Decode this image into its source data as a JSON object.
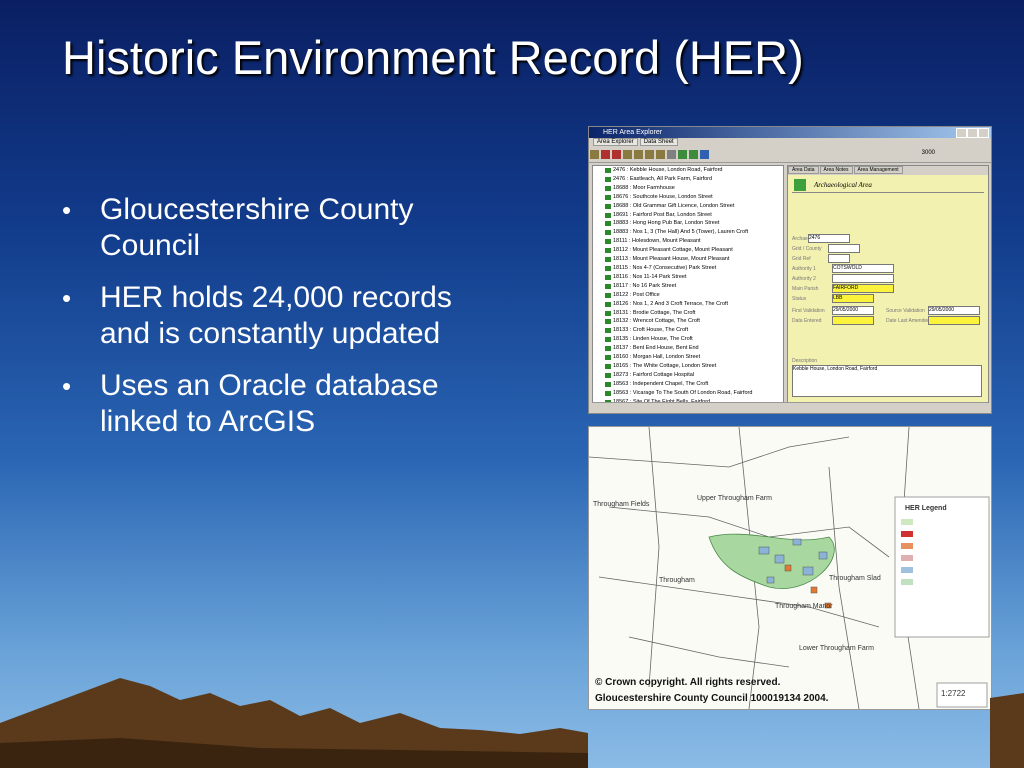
{
  "slide": {
    "title": "Historic Environment Record (HER)",
    "bullets": [
      "Gloucestershire County Council",
      "HER holds 24,000 records and is constantly updated",
      "Uses an Oracle database linked to ArcGIS"
    ],
    "bullet_glyph": "•",
    "colors": {
      "title": "#ffffff",
      "bg_top": "#0a1f63",
      "bg_bottom": "#8bbbe6",
      "mountains": "#5a3a1a"
    }
  },
  "her_window": {
    "title": "HER Area Explorer",
    "tabs": [
      "Area Explorer",
      "Data Sheet"
    ],
    "record_count": "3000",
    "tree_items": [
      "2476 : Kebble House, London Road, Fairford",
      "2476 : Eastleach, All Park Farm, Fairford",
      "18688 : Moor Farmhouse",
      "18676 : Southcote House, London Street",
      "18688 : Old Grammar Gift Licence, London Street",
      "18691 : Fairford Post Bar, London Street",
      "18883 : Hong Hong Pub Bar, London Street",
      "18883 : Nos 1, 3 (The Hall) And 5 (Tower), Lauren Croft",
      "18111 : Holesdown, Mount Pleasant",
      "18112 : Mount Pleasant Cottage, Mount Pleasant",
      "18113 : Mount Pleasant House, Mount Pleasant",
      "18115 : Nos 4-7 (Consecutive) Park Street",
      "18116 : Nos 11-14 Park Street",
      "18117 : No 16 Park Street",
      "18122 : Post Office",
      "18126 : Nos 1, 2 And 3 Croft Terrace, The Croft",
      "18131 : Brodie Cottage, The Croft",
      "18132 : Wrencot Cottage, The Croft",
      "18133 : Croft House, The Croft",
      "18135 : Linden House, The Croft",
      "18137 : Bent End House, Bent End",
      "18160 : Morgan Hall, London Street",
      "18165 : The White Cottage, London Street",
      "18273 : Fairford Cottage Hospital",
      "18563 : Independent Chapel, The Croft",
      "18563 : Vicarage To The South Of London Road, Fairford",
      "18567 : Site Of The Eight Bells, Fairford"
    ],
    "panel_tabs": [
      "Area Data",
      "Area Notes",
      "Area Management"
    ],
    "panel_header": "Archaeological Area",
    "fields": [
      {
        "label": "Archaeological Area",
        "value": "2476",
        "yellow": false
      },
      {
        "label": "Grid / County",
        "value": "",
        "yellow": false
      },
      {
        "label": "Grid Ref",
        "value": "",
        "yellow": false
      },
      {
        "label": "Authority 1",
        "value": "COTSWOLD",
        "yellow": false
      },
      {
        "label": "Authority 2",
        "value": "",
        "yellow": false
      },
      {
        "label": "Main Parish",
        "value": "FAIRFORD",
        "yellow": true
      },
      {
        "label": "Status",
        "value": "LBB",
        "yellow": true
      },
      {
        "label": "First Validation",
        "value": "29/05/2000",
        "yellow": false
      },
      {
        "label": "Source Validation",
        "value": "29/05/2000",
        "yellow": false
      },
      {
        "label": "Data Entered",
        "value": "",
        "yellow": true
      },
      {
        "label": "Date Last Amended",
        "value": "",
        "yellow": true
      }
    ],
    "description_label": "Description",
    "description": "Kebble House, London Road, Fairford"
  },
  "map": {
    "labels": [
      "Upper Througham Farm",
      "Througham",
      "Througham Manor",
      "Througham Slad",
      "Lower Througham Farm",
      "Througham Fields"
    ],
    "legend_title": "HER Legend",
    "copyright": "© Crown copyright. All rights reserved.",
    "licence": "Gloucestershire County Council 100019134 2004.",
    "scale": "1:2722"
  }
}
